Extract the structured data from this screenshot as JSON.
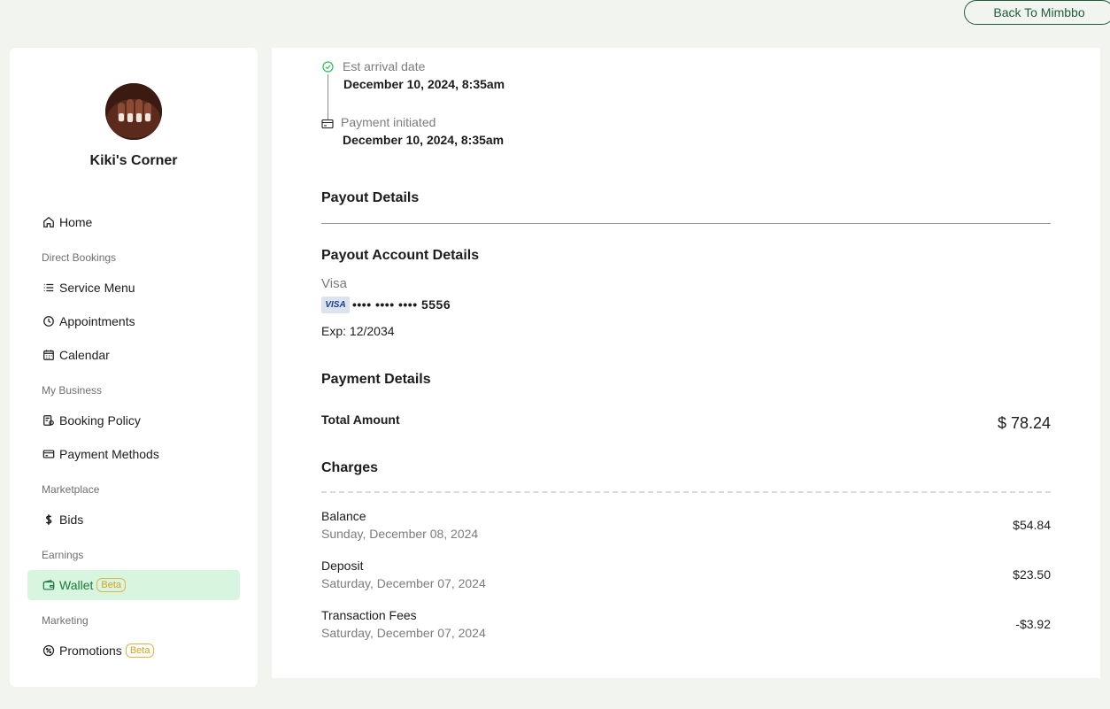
{
  "header": {
    "back_label": "Back To Mimbbo"
  },
  "sidebar": {
    "business_name": "Kiki's Corner",
    "home": "Home",
    "sections": {
      "direct_bookings": "Direct Bookings",
      "my_business": "My Business",
      "marketplace": "Marketplace",
      "earnings": "Earnings",
      "marketing": "Marketing"
    },
    "items": {
      "service_menu": "Service Menu",
      "appointments": "Appointments",
      "calendar": "Calendar",
      "booking_policy": "Booking Policy",
      "payment_methods": "Payment Methods",
      "bids": "Bids",
      "wallet": "Wallet",
      "promotions": "Promotions"
    },
    "beta_label": "Beta"
  },
  "timeline": {
    "arrival_label": "Est arrival date",
    "arrival_value": "December 10, 2024, 8:35am",
    "initiated_label": "Payment initiated",
    "initiated_value": "December 10, 2024, 8:35am"
  },
  "payout": {
    "title": "Payout Details",
    "account_title": "Payout Account Details",
    "card_brand": "Visa",
    "card_logo": "VISA",
    "card_number": "•••• •••• •••• 5556",
    "expiry": "Exp: 12/2034"
  },
  "payment": {
    "title": "Payment Details",
    "total_label": "Total Amount",
    "total_value": "$ 78.24"
  },
  "charges": {
    "title": "Charges",
    "items": [
      {
        "name": "Balance",
        "date": "Sunday, December 08, 2024",
        "amount": "$54.84"
      },
      {
        "name": "Deposit",
        "date": "Saturday, December 07, 2024",
        "amount": "$23.50"
      },
      {
        "name": "Transaction Fees",
        "date": "Saturday, December 07, 2024",
        "amount": "-$3.92"
      }
    ]
  },
  "colors": {
    "accent": "#1a7a3d",
    "active_bg": "#d8f6df",
    "beta": "#d8a020"
  }
}
